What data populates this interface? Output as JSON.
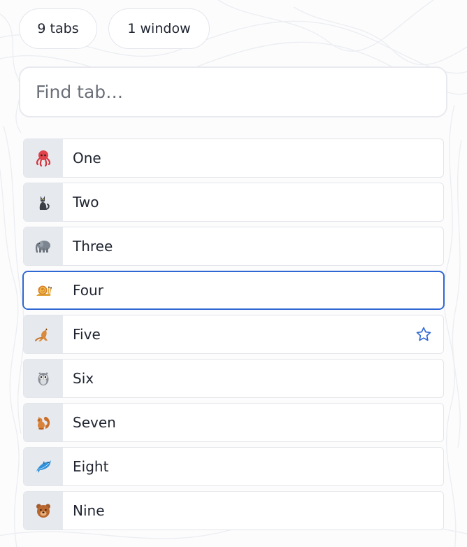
{
  "summary": {
    "tab_count": "9 tabs",
    "window_count": "1 window"
  },
  "search": {
    "placeholder": "Find tab…",
    "value": ""
  },
  "colors": {
    "accent": "#2f68d4",
    "favicon_bg": "#e6e9ee",
    "border": "#e2e5ea"
  },
  "tabs": [
    {
      "title": "One",
      "icon": "octopus-icon",
      "active": false,
      "bookmarked": false
    },
    {
      "title": "Two",
      "icon": "cat-icon",
      "active": false,
      "bookmarked": false
    },
    {
      "title": "Three",
      "icon": "elephant-icon",
      "active": false,
      "bookmarked": false
    },
    {
      "title": "Four",
      "icon": "snail-icon",
      "active": true,
      "bookmarked": false
    },
    {
      "title": "Five",
      "icon": "kangaroo-icon",
      "active": false,
      "bookmarked": true
    },
    {
      "title": "Six",
      "icon": "owl-icon",
      "active": false,
      "bookmarked": false
    },
    {
      "title": "Seven",
      "icon": "squirrel-icon",
      "active": false,
      "bookmarked": false
    },
    {
      "title": "Eight",
      "icon": "dolphin-icon",
      "active": false,
      "bookmarked": false
    },
    {
      "title": "Nine",
      "icon": "bear-icon",
      "active": false,
      "bookmarked": false
    }
  ]
}
